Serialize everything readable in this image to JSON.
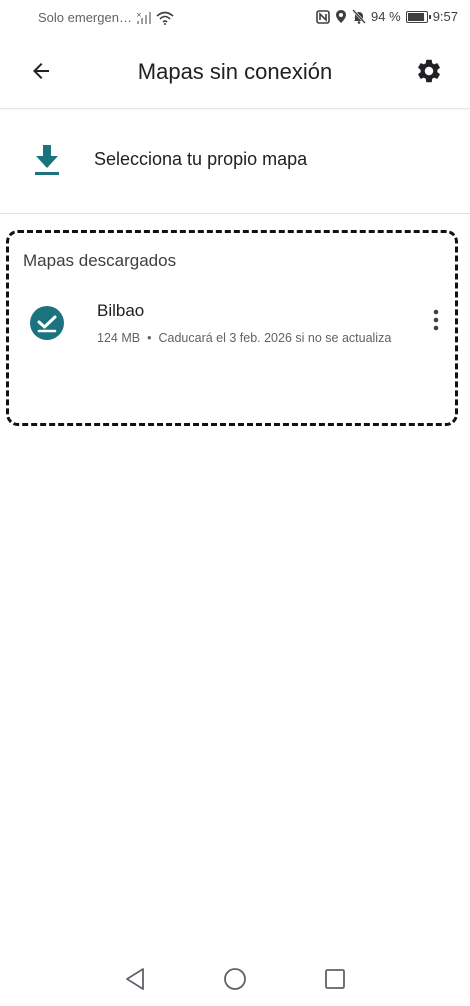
{
  "status_bar": {
    "carrier": "Solo emergen…",
    "battery_percent_label": "94 %",
    "battery_level": 0.94,
    "time": "9:57",
    "icons": [
      "signal-off-icon",
      "wifi-icon",
      "nfc-icon",
      "location-icon",
      "bell-off-icon",
      "battery-icon"
    ]
  },
  "app_bar": {
    "title": "Mapas sin conexión",
    "back_icon": "arrow-back-icon",
    "settings_icon": "gear-icon"
  },
  "select_map": {
    "label": "Selecciona tu propio mapa",
    "icon": "download-icon",
    "accent": "#1a737e"
  },
  "downloaded": {
    "title": "Mapas descargados",
    "items": [
      {
        "name": "Bilbao",
        "size": "124 MB",
        "separator": "•",
        "expiry": "Caducará el 3 feb. 2026 si no se actualiza",
        "icon": "check-circle-icon"
      }
    ]
  },
  "nav_bar": {
    "icons": [
      "nav-back-icon",
      "nav-home-icon",
      "nav-recents-icon"
    ]
  },
  "colors": {
    "accent": "#1a737e",
    "text_primary": "#202124",
    "text_secondary": "#5f6368"
  }
}
